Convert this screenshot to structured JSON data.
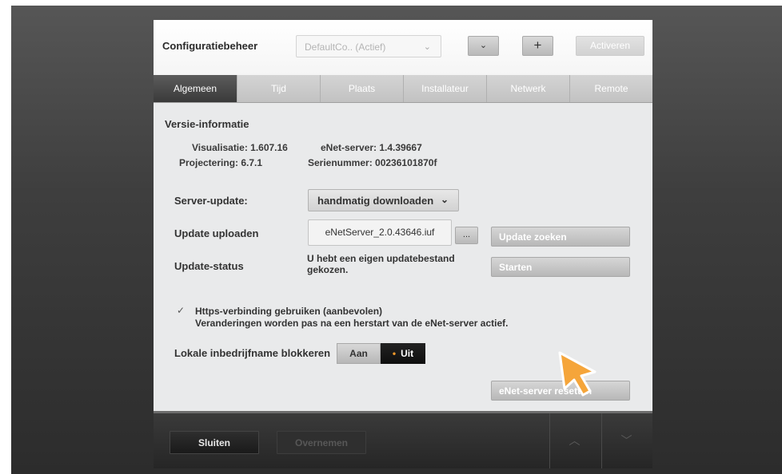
{
  "header": {
    "title": "Configuratiebeheer",
    "config_select": "DefaultCo.. (Actief)",
    "down_button": "⌄",
    "plus_button": "+",
    "activate_button": "Activeren"
  },
  "tabs": [
    {
      "label": "Algemeen",
      "active": true
    },
    {
      "label": "Tijd",
      "active": false
    },
    {
      "label": "Plaats",
      "active": false
    },
    {
      "label": "Installateur",
      "active": false
    },
    {
      "label": "Netwerk",
      "active": false
    },
    {
      "label": "Remote",
      "active": false
    }
  ],
  "version": {
    "title": "Versie-informatie",
    "visualisatie": "Visualisatie: 1.607.16",
    "projectering": "Projectering: 6.7.1",
    "enet_server": "eNet-server: 1.4.39667",
    "serienummer": "Serienummer: 00236101870f"
  },
  "server_update": {
    "label": "Server-update:",
    "value": "handmatig downloaden"
  },
  "update_upload": {
    "label": "Update uploaden",
    "file": "eNetServer_2.0.43646.iuf",
    "browse_button": "...",
    "search_button": "Update zoeken"
  },
  "update_status": {
    "label": "Update-status",
    "text_line1": "U hebt een eigen updatebestand",
    "text_line2": "gekozen.",
    "start_button": "Starten"
  },
  "https": {
    "checked": true,
    "checkmark": "✓",
    "line1": "Https-verbinding gebruiken (aanbevolen)",
    "line2": "Veranderingen worden pas na een herstart van de eNet-server actief."
  },
  "local_block": {
    "label": "Lokale inbedrijfname blokkeren",
    "on_label": "Aan",
    "off_label": "Uit",
    "selected": "Uit"
  },
  "reset_button": "eNet-server resetten",
  "footer": {
    "close_button": "Sluiten",
    "apply_button": "Overnemen",
    "up_icon": "︿",
    "down_icon": "﹀"
  },
  "colors": {
    "accent_orange": "#f29a2a",
    "active_tab": "#3a3a3a"
  }
}
